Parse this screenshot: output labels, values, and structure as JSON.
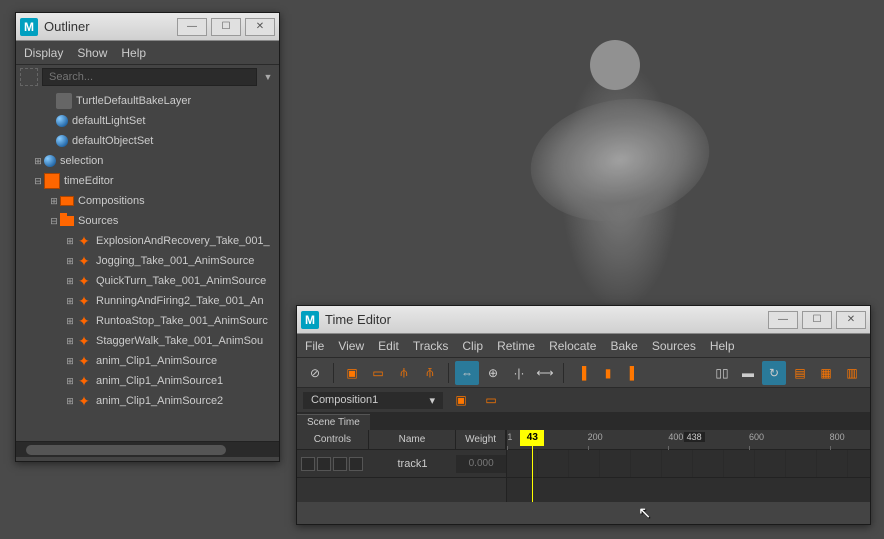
{
  "outliner": {
    "title": "Outliner",
    "menu": [
      "Display",
      "Show",
      "Help"
    ],
    "search_placeholder": "Search...",
    "items": [
      {
        "indent": 28,
        "icon": "turtle",
        "label": "TurtleDefaultBakeLayer"
      },
      {
        "indent": 28,
        "icon": "sphere",
        "label": "defaultLightSet"
      },
      {
        "indent": 28,
        "icon": "sphere",
        "label": "defaultObjectSet"
      },
      {
        "indent": 16,
        "exp": "⊞",
        "icon": "sphere",
        "label": "selection"
      },
      {
        "indent": 16,
        "exp": "⊟",
        "icon": "teditor",
        "label": "timeEditor"
      },
      {
        "indent": 32,
        "exp": "⊞",
        "icon": "comp",
        "label": "Compositions"
      },
      {
        "indent": 32,
        "exp": "⊟",
        "icon": "folder",
        "label": "Sources"
      },
      {
        "indent": 48,
        "exp": "⊞",
        "icon": "anim",
        "label": "ExplosionAndRecovery_Take_001_"
      },
      {
        "indent": 48,
        "exp": "⊞",
        "icon": "anim",
        "label": "Jogging_Take_001_AnimSource"
      },
      {
        "indent": 48,
        "exp": "⊞",
        "icon": "anim",
        "label": "QuickTurn_Take_001_AnimSource"
      },
      {
        "indent": 48,
        "exp": "⊞",
        "icon": "anim",
        "label": "RunningAndFiring2_Take_001_An"
      },
      {
        "indent": 48,
        "exp": "⊞",
        "icon": "anim",
        "label": "RuntoaStop_Take_001_AnimSourc"
      },
      {
        "indent": 48,
        "exp": "⊞",
        "icon": "anim",
        "label": "StaggerWalk_Take_001_AnimSou"
      },
      {
        "indent": 48,
        "exp": "⊞",
        "icon": "anim",
        "label": "anim_Clip1_AnimSource"
      },
      {
        "indent": 48,
        "exp": "⊞",
        "icon": "anim",
        "label": "anim_Clip1_AnimSource1"
      },
      {
        "indent": 48,
        "exp": "⊞",
        "icon": "anim",
        "label": "anim_Clip1_AnimSource2"
      }
    ]
  },
  "timeEditor": {
    "title": "Time Editor",
    "menu": [
      "File",
      "View",
      "Edit",
      "Tracks",
      "Clip",
      "Retime",
      "Relocate",
      "Bake",
      "Sources",
      "Help"
    ],
    "composition": "Composition1",
    "scene_time_label": "Scene Time",
    "headers": {
      "controls": "Controls",
      "name": "Name",
      "weight": "Weight"
    },
    "track": {
      "name": "track1",
      "weight": "0.000"
    },
    "timeline": {
      "ticks": [
        1,
        200,
        400,
        600,
        800
      ],
      "playhead": 43,
      "frame_end": 438
    }
  }
}
